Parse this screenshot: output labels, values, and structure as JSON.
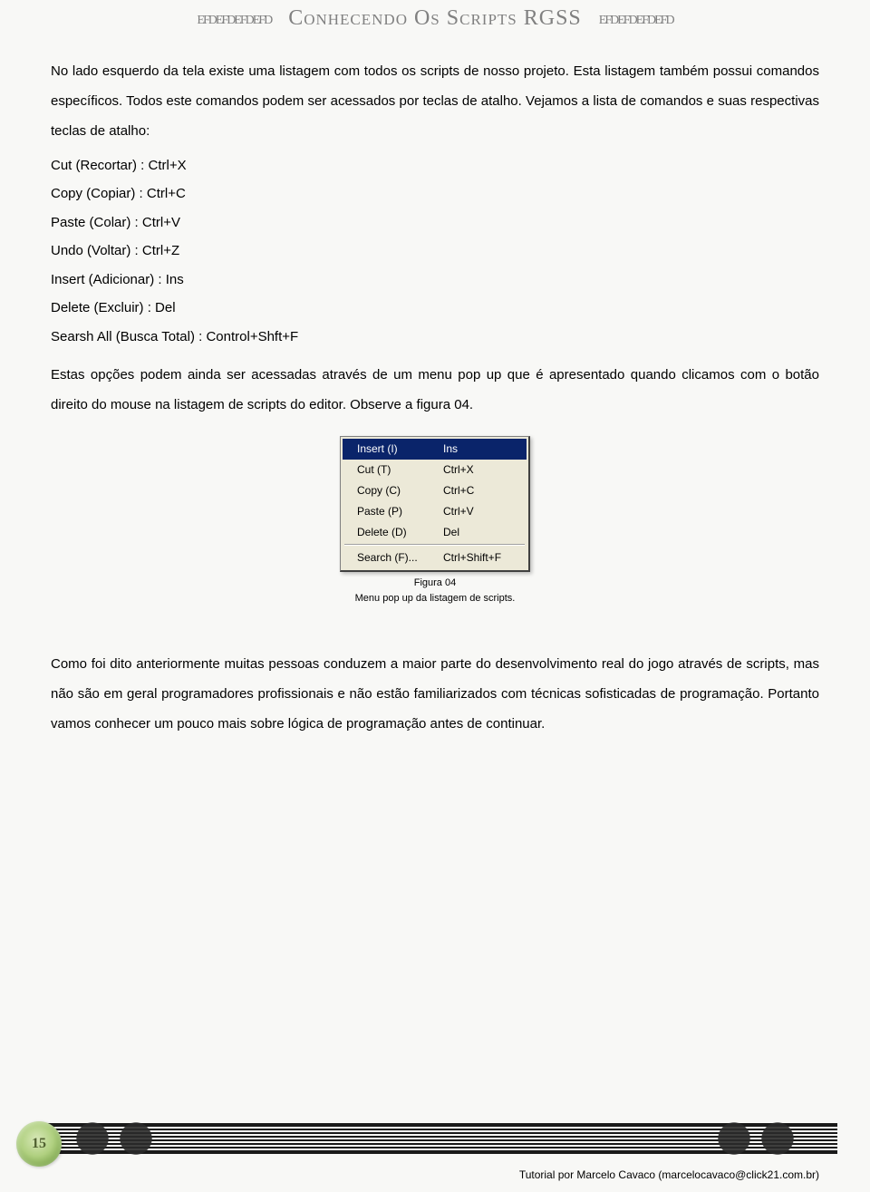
{
  "header": {
    "ornament": "efdefdefdefd",
    "title": "Conhecendo Os Scripts RGSS"
  },
  "paragraphs": {
    "p1": "No lado esquerdo da tela existe uma listagem com todos os scripts de nosso projeto. Esta listagem também possui comandos específicos. Todos este comandos podem ser acessados por teclas de atalho. Vejamos a lista de comandos e suas respectivas teclas de atalho:",
    "p2": "Estas opções podem ainda ser acessadas através de um menu pop up que é apresentado quando clicamos com o botão direito do mouse na listagem de scripts do editor. Observe a figura 04.",
    "p3": "Como foi dito anteriormente muitas pessoas conduzem a maior parte do desenvolvimento real do jogo através de scripts, mas não são em geral programadores profissionais e não estão familiarizados com técnicas sofisticadas de programação. Portanto vamos conhecer um pouco mais sobre lógica de programação antes de continuar."
  },
  "shortcuts": [
    "Cut (Recortar) : Ctrl+X",
    "Copy (Copiar) : Ctrl+C",
    "Paste (Colar) : Ctrl+V",
    "Undo (Voltar) : Ctrl+Z",
    "Insert (Adicionar) : Ins",
    "Delete (Excluir) : Del",
    "Searsh All (Busca Total) : Control+Shft+F"
  ],
  "context_menu": {
    "items": [
      {
        "label": "Insert (I)",
        "shortcut": "Ins",
        "highlighted": true
      },
      {
        "label": "Cut (T)",
        "shortcut": "Ctrl+X",
        "highlighted": false
      },
      {
        "label": "Copy (C)",
        "shortcut": "Ctrl+C",
        "highlighted": false
      },
      {
        "label": "Paste (P)",
        "shortcut": "Ctrl+V",
        "highlighted": false
      },
      {
        "label": "Delete (D)",
        "shortcut": "Del",
        "highlighted": false
      }
    ],
    "footer_item": {
      "label": "Search (F)...",
      "shortcut": "Ctrl+Shift+F"
    }
  },
  "figure": {
    "label": "Figura 04",
    "caption": "Menu pop up da listagem de scripts."
  },
  "footer": {
    "page_number": "15",
    "credit": "Tutorial por Marcelo Cavaco (marcelocavaco@click21.com.br)"
  }
}
